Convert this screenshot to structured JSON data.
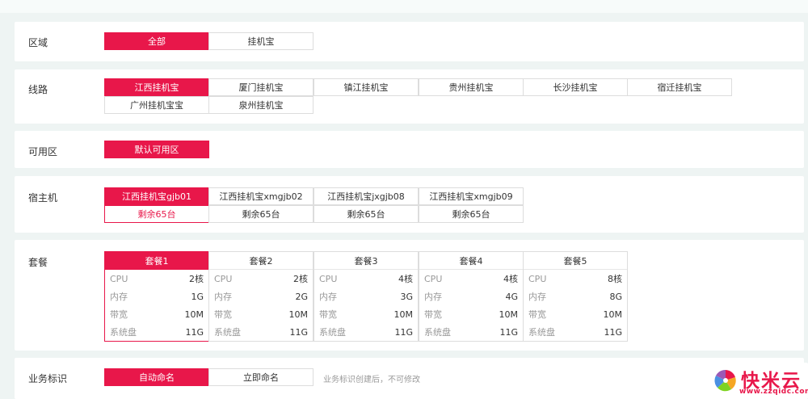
{
  "region": {
    "label": "区域",
    "options": [
      "全部",
      "挂机宝"
    ]
  },
  "line": {
    "label": "线路",
    "options": [
      "江西挂机宝",
      "厦门挂机宝",
      "镇江挂机宝",
      "贵州挂机宝",
      "长沙挂机宝",
      "宿迁挂机宝",
      "广州挂机宝宝",
      "泉州挂机宝"
    ]
  },
  "zone": {
    "label": "可用区",
    "options": [
      "默认可用区"
    ]
  },
  "host": {
    "label": "宿主机",
    "options": [
      {
        "name": "江西挂机宝gjb01",
        "remain": "剩余65台"
      },
      {
        "name": "江西挂机宝xmgjb02",
        "remain": "剩余65台"
      },
      {
        "name": "江西挂机宝jxgjb08",
        "remain": "剩余65台"
      },
      {
        "name": "江西挂机宝xmgjb09",
        "remain": "剩余65台"
      }
    ]
  },
  "package": {
    "label": "套餐",
    "spec_keys": {
      "cpu": "CPU",
      "mem": "内存",
      "bw": "带宽",
      "disk": "系统盘"
    },
    "options": [
      {
        "name": "套餐1",
        "cpu": "2核",
        "mem": "1G",
        "bw": "10M",
        "disk": "11G"
      },
      {
        "name": "套餐2",
        "cpu": "2核",
        "mem": "2G",
        "bw": "10M",
        "disk": "11G"
      },
      {
        "name": "套餐3",
        "cpu": "4核",
        "mem": "3G",
        "bw": "10M",
        "disk": "11G"
      },
      {
        "name": "套餐4",
        "cpu": "4核",
        "mem": "4G",
        "bw": "10M",
        "disk": "11G"
      },
      {
        "name": "套餐5",
        "cpu": "8核",
        "mem": "8G",
        "bw": "10M",
        "disk": "11G"
      }
    ]
  },
  "business": {
    "label": "业务标识",
    "options": [
      "自动命名",
      "立即命名"
    ],
    "hint": "业务标识创建后，不可修改"
  },
  "watermark": {
    "text": "快米云",
    "url": "www.zzqidc.com"
  },
  "colors": {
    "accent": "#e8174a",
    "border": "#dddddd",
    "background": "#eef4f3"
  }
}
